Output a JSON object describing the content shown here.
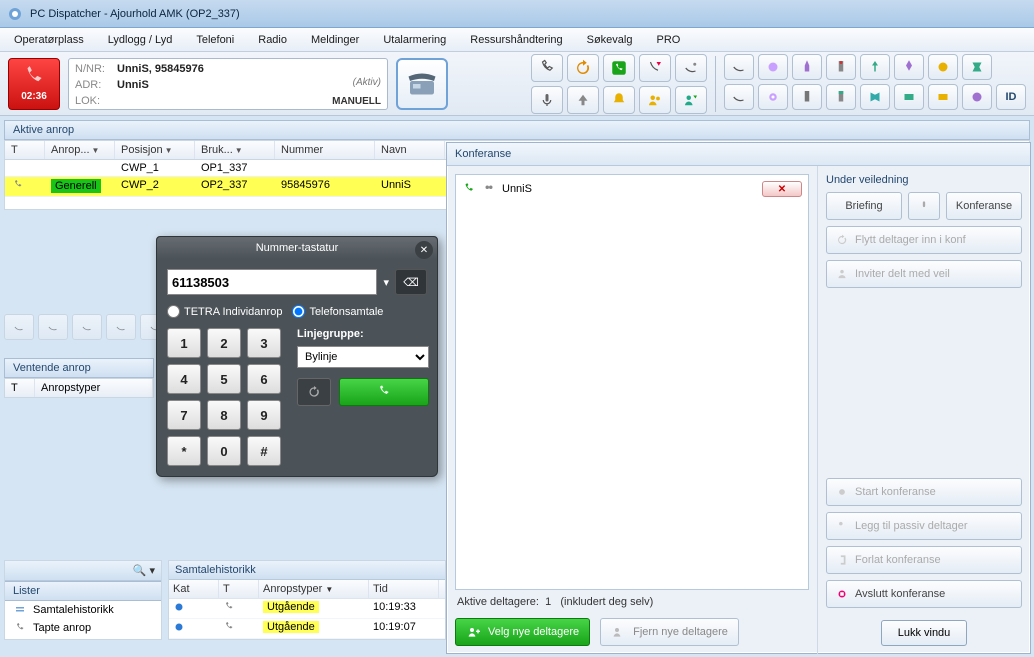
{
  "window": {
    "title": "PC Dispatcher -  Ajourhold AMK (OP2_337)"
  },
  "menu": [
    "Operatørplass",
    "Lydlogg / Lyd",
    "Telefoni",
    "Radio",
    "Meldinger",
    "Utalarmering",
    "Ressurshåndtering",
    "Søkevalg",
    "PRO"
  ],
  "call": {
    "time": "02:36",
    "nnr_label": "N/NR:",
    "nnr": "UnniS, 95845976",
    "adr_label": "ADR:",
    "adr": "UnniS",
    "lok_label": "LOK:",
    "lok": "",
    "status": "(Aktiv)",
    "mode": "MANUELL"
  },
  "sections": {
    "active": "Aktive anrop",
    "waiting": "Ventende anrop",
    "hist": "Samtalehistorikk",
    "lister": "Lister"
  },
  "active_cols": {
    "t": "T",
    "anrop": "Anrop...",
    "pos": "Posisjon",
    "bruk": "Bruk...",
    "num": "Nummer",
    "navn": "Navn"
  },
  "active_rows": [
    {
      "t": "",
      "anrop": "",
      "pos": "CWP_1",
      "bruk": "OP1_337",
      "num": "",
      "navn": "",
      "hl": false
    },
    {
      "t": "📞",
      "anrop": "Generell",
      "pos": "CWP_2",
      "bruk": "OP2_337",
      "num": "95845976",
      "navn": "UnniS",
      "hl": true
    }
  ],
  "waiting_cols": {
    "t": "T",
    "type": "Anropstyper"
  },
  "dialer": {
    "title": "Nummer-tastatur",
    "number": "61138503",
    "r1": "TETRA Individanrop",
    "r2": "Telefonsamtale",
    "lg_label": "Linjegruppe:",
    "lg_value": "Bylinje",
    "keys": [
      "1",
      "2",
      "3",
      "4",
      "5",
      "6",
      "7",
      "8",
      "9",
      "*",
      "0",
      "#"
    ]
  },
  "conf": {
    "title": "Konferanse",
    "entry": "UnniS",
    "aktive_label": "Aktive deltagere:",
    "aktive_count": "1",
    "aktive_suffix": "(inkludert deg selv)",
    "velg": "Velg nye deltagere",
    "fjern": "Fjern nye deltagere",
    "side_title": "Under veiledning",
    "briefing": "Briefing",
    "konf_btn": "Konferanse",
    "flytt": "Flytt deltager inn i konf",
    "inviter": "Inviter delt med veil",
    "start": "Start konferanse",
    "legg": "Legg til passiv deltager",
    "forlat": "Forlat konferanse",
    "avslutt": "Avslutt konferanse",
    "lukk": "Lukk vindu"
  },
  "lister_items": [
    "Samtalehistorikk",
    "Tapte anrop"
  ],
  "hist_cols": {
    "kat": "Kat",
    "t": "T",
    "type": "Anropstyper",
    "tid": "Tid"
  },
  "hist_rows": [
    {
      "kat": "●",
      "t": "📞",
      "type": "Utgående",
      "tid": "10:19:33"
    },
    {
      "kat": "●",
      "t": "📞",
      "type": "Utgående",
      "tid": "10:19:07"
    }
  ],
  "id_btn": "ID"
}
